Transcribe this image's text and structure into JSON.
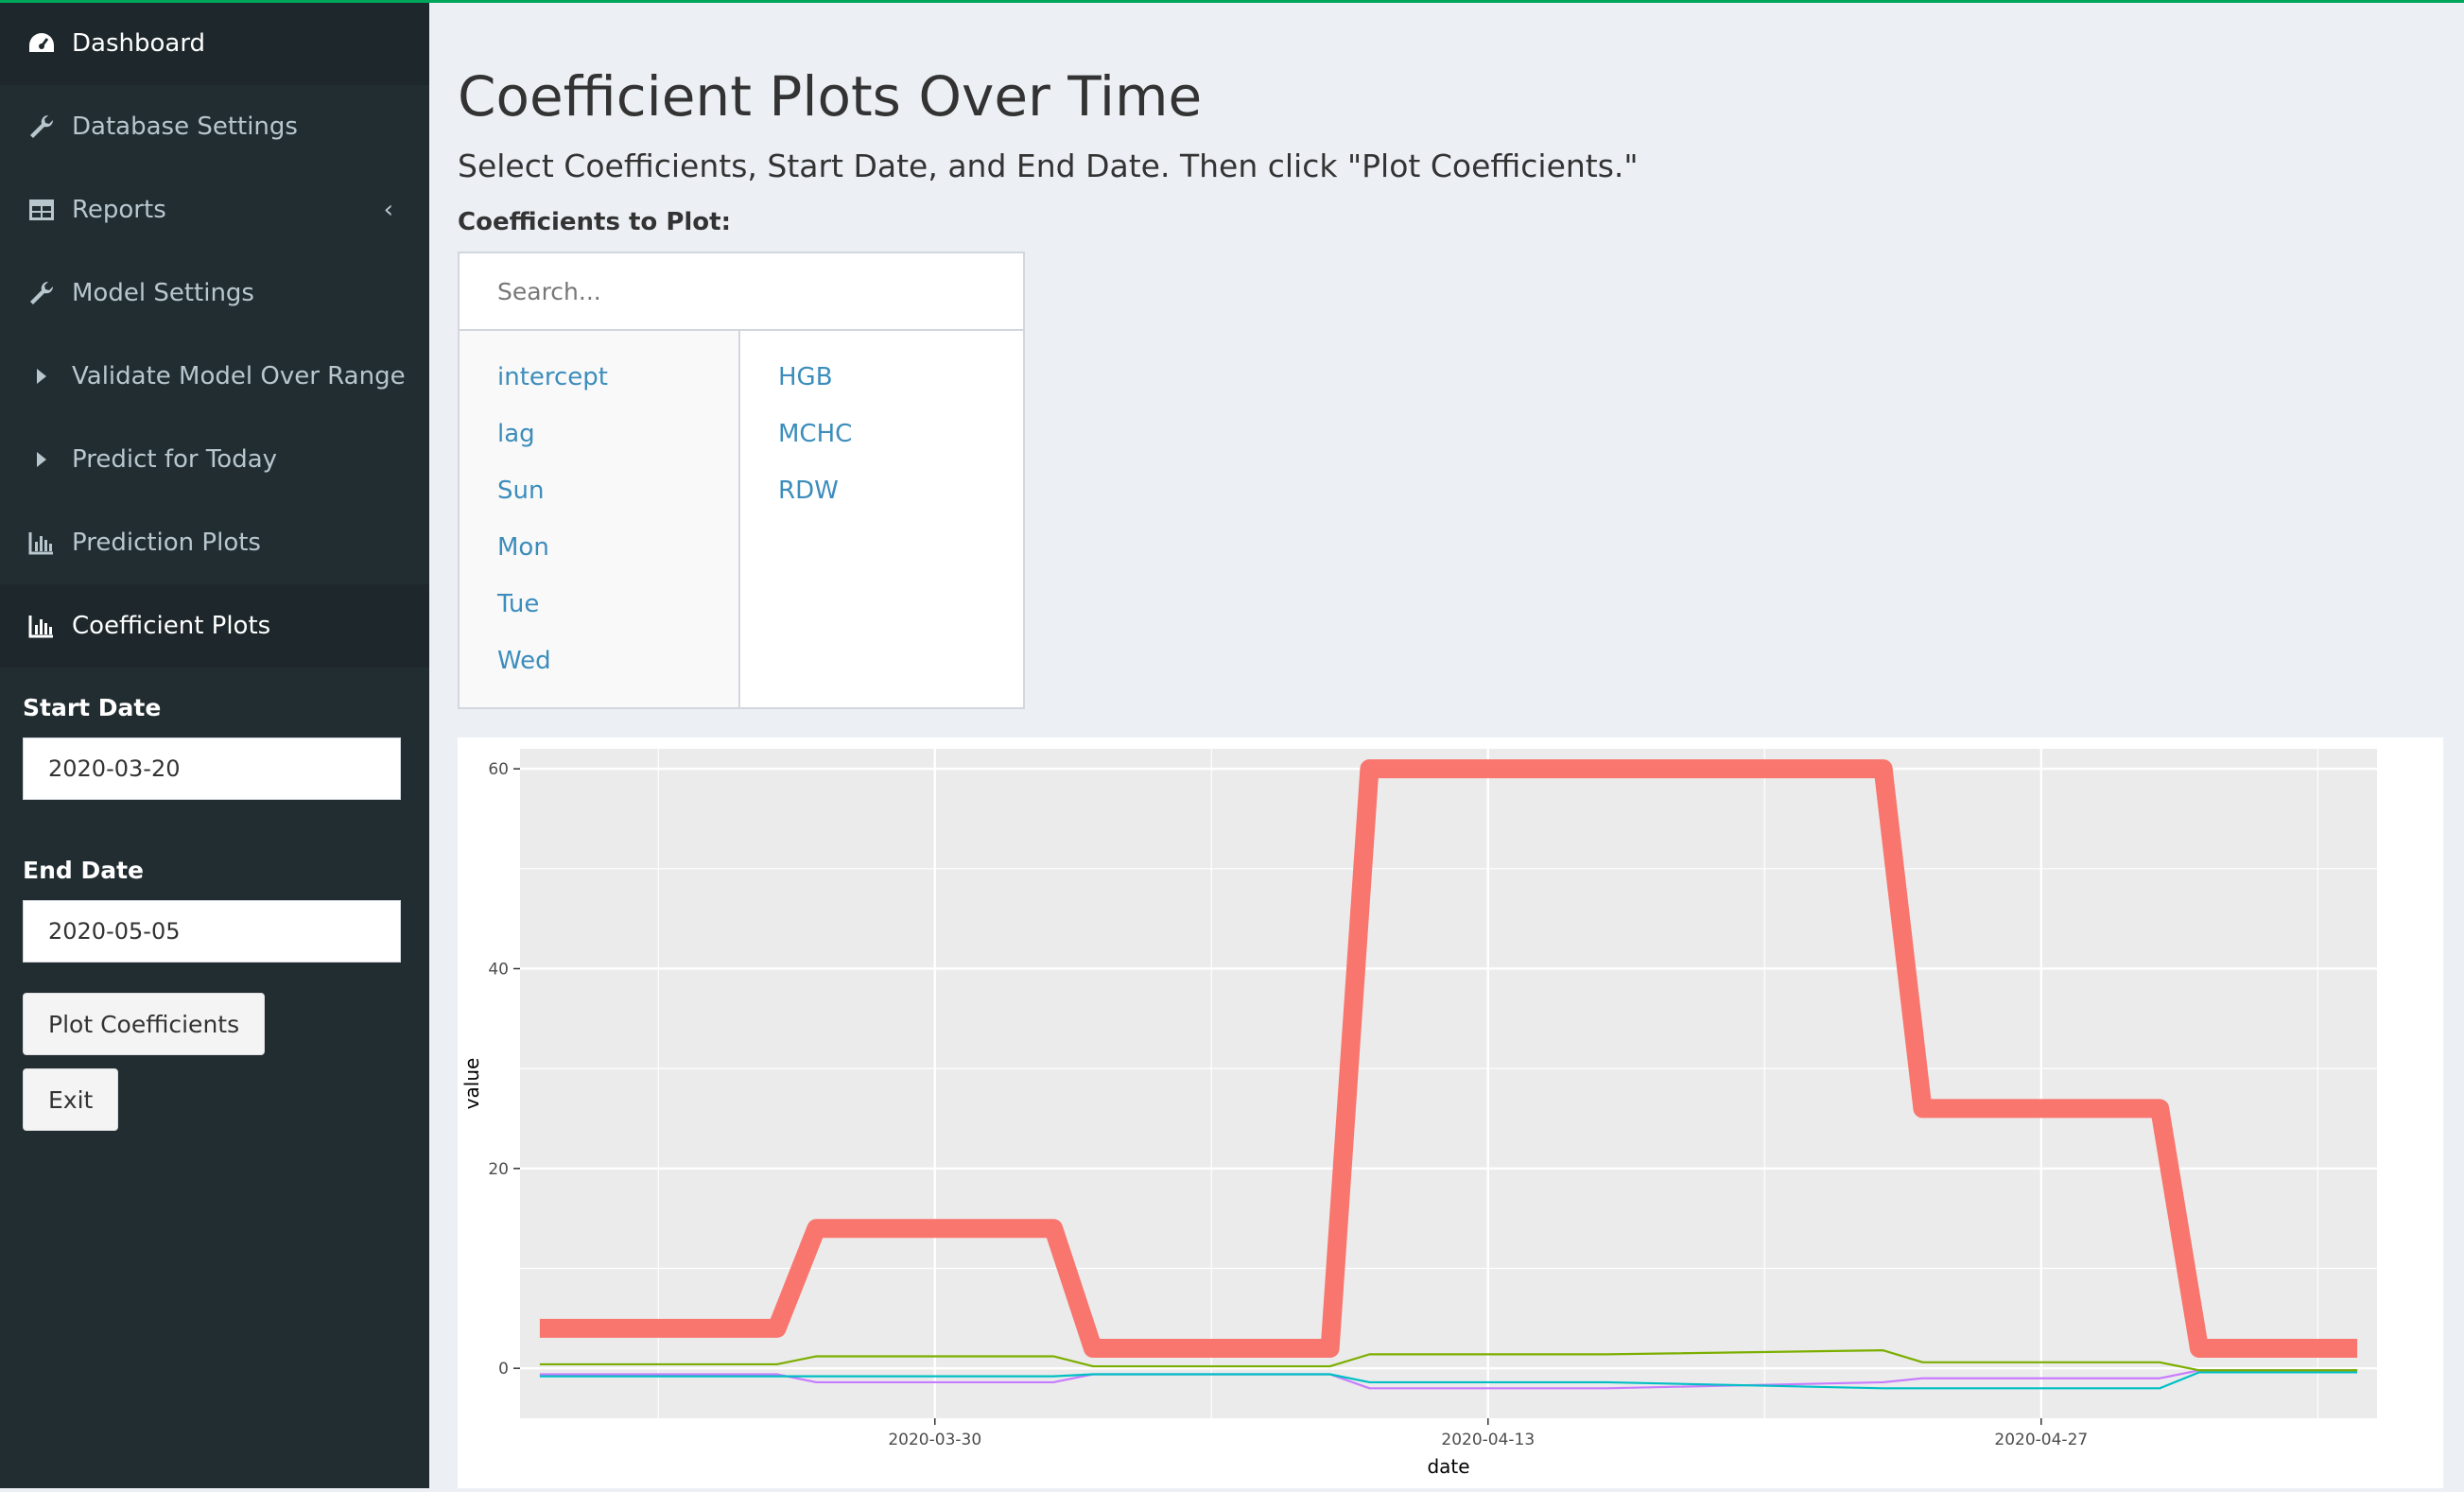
{
  "sidebar": {
    "items": [
      {
        "label": "Dashboard",
        "icon": "dashboard-icon",
        "chevron": ""
      },
      {
        "label": "Database Settings",
        "icon": "wrench-icon",
        "chevron": ""
      },
      {
        "label": "Reports",
        "icon": "table-icon",
        "chevron": "‹"
      },
      {
        "label": "Model Settings",
        "icon": "wrench-icon",
        "chevron": ""
      },
      {
        "label": "Validate Model Over Range",
        "icon": "caret-right-icon",
        "chevron": ""
      },
      {
        "label": "Predict for Today",
        "icon": "caret-right-icon",
        "chevron": ""
      },
      {
        "label": "Prediction Plots",
        "icon": "bar-chart-icon",
        "chevron": ""
      },
      {
        "label": "Coefficient Plots",
        "icon": "bar-chart-icon",
        "chevron": ""
      }
    ],
    "active_item": "Coefficient Plots",
    "start_date_label": "Start Date",
    "start_date_value": "2020-03-20",
    "end_date_label": "End Date",
    "end_date_value": "2020-05-05",
    "plot_button": "Plot Coefficients",
    "exit_button": "Exit"
  },
  "main": {
    "title": "Coefficient Plots Over Time",
    "instructions": "Select Coefficients, Start Date, and End Date. Then click \"Plot Coefficients.\"",
    "coef_label": "Coefficients to Plot:",
    "search_placeholder": "Search...",
    "options_left": [
      "intercept",
      "lag",
      "Sun",
      "Mon",
      "Tue",
      "Wed"
    ],
    "options_right": [
      "HGB",
      "MCHC",
      "RDW"
    ]
  },
  "colors": {
    "sidebar_bg": "#222d32",
    "page_bg": "#ecf0f5",
    "link": "#3c8dbc",
    "accent_line": "#00a65a"
  },
  "chart_data": {
    "type": "line",
    "xlabel": "date",
    "ylabel": "value",
    "x_ticks": [
      "2020-03-30",
      "2020-04-13",
      "2020-04-27"
    ],
    "y_ticks": [
      "0",
      "20",
      "40",
      "60"
    ],
    "xlim": [
      "2020-03-20",
      "2020-05-05"
    ],
    "ylim": [
      -5,
      62
    ],
    "grid": true,
    "legend": "none",
    "x": [
      "2020-03-20",
      "2020-03-26",
      "2020-03-27",
      "2020-04-02",
      "2020-04-03",
      "2020-04-09",
      "2020-04-10",
      "2020-04-16",
      "2020-04-23",
      "2020-04-24",
      "2020-04-30",
      "2020-05-01",
      "2020-05-05"
    ],
    "series": [
      {
        "color": "#f8766d",
        "width": "thick",
        "values": [
          4,
          4,
          14,
          14,
          2,
          2,
          60,
          60,
          60,
          26,
          26,
          2,
          2
        ]
      },
      {
        "color": "#7cae00",
        "width": "thin",
        "values": [
          0.4,
          0.4,
          1.2,
          1.2,
          0.2,
          0.2,
          1.4,
          1.4,
          1.8,
          0.6,
          0.6,
          -0.2,
          -0.2
        ]
      },
      {
        "color": "#00bfc4",
        "width": "thin",
        "values": [
          -0.8,
          -0.8,
          -0.8,
          -0.8,
          -0.6,
          -0.6,
          -1.4,
          -1.4,
          -2.0,
          -2.0,
          -2.0,
          -0.4,
          -0.4
        ]
      },
      {
        "color": "#c77cff",
        "width": "thin",
        "values": [
          -0.6,
          -0.6,
          -1.4,
          -1.4,
          -0.6,
          -0.6,
          -2.0,
          -2.0,
          -1.4,
          -1.0,
          -1.0,
          -0.2,
          -0.2
        ]
      }
    ]
  }
}
